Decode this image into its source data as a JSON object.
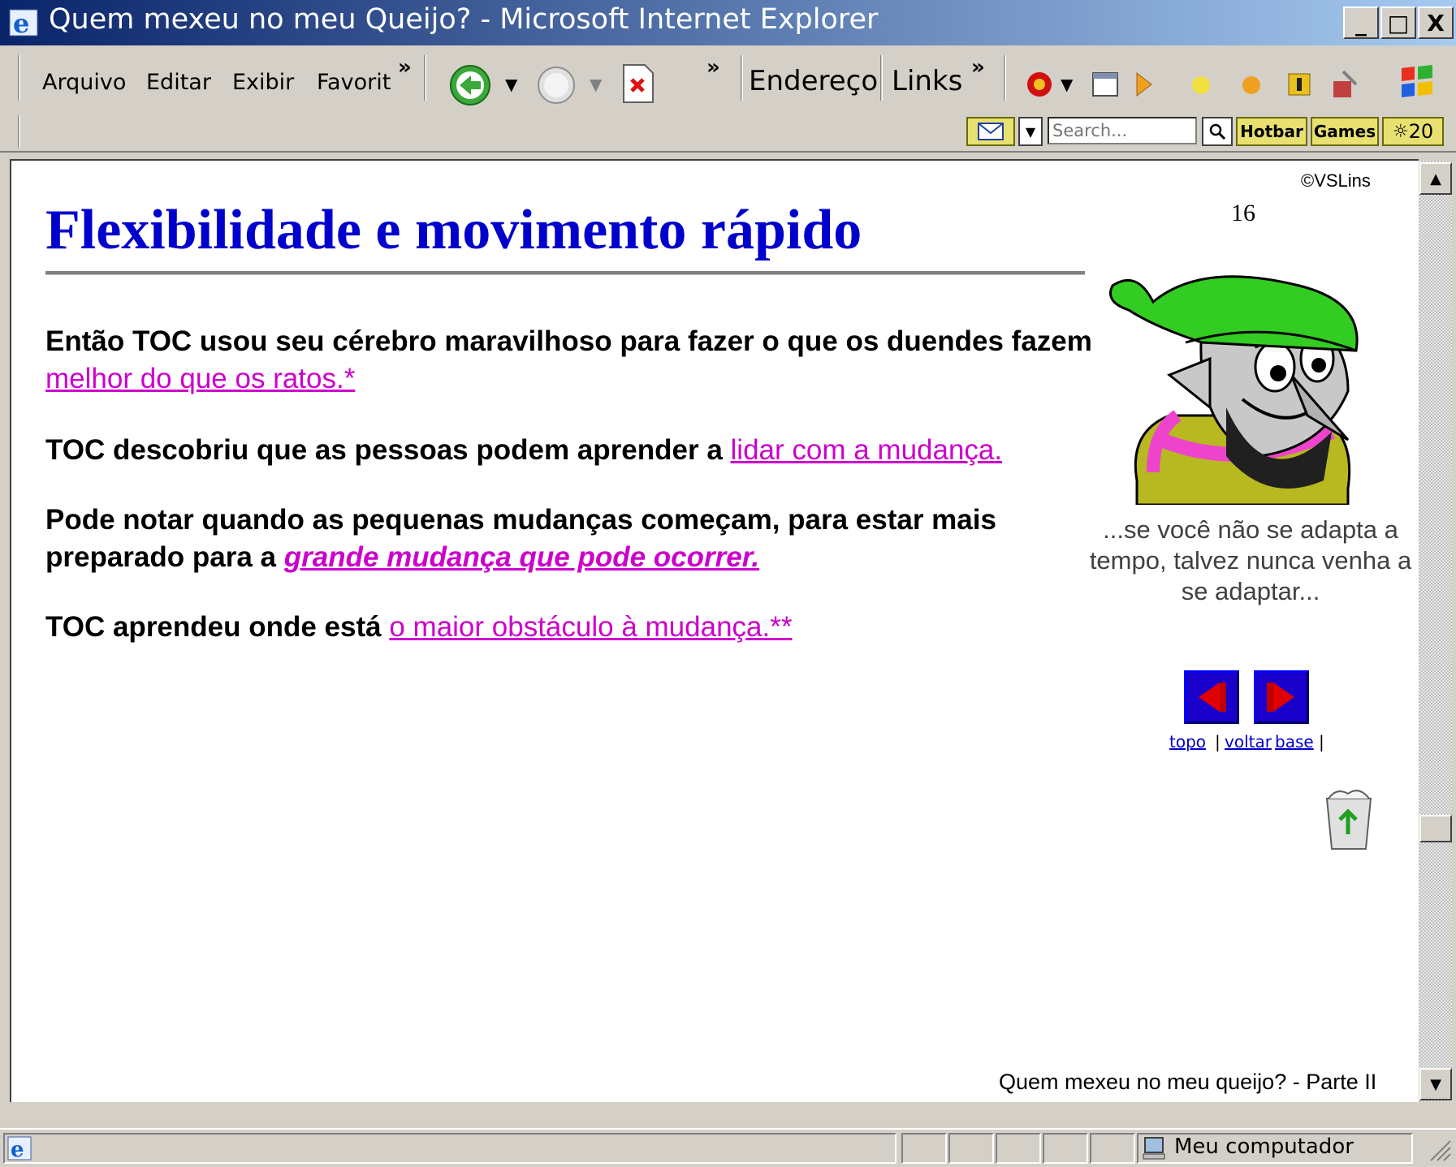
{
  "window": {
    "title": "Quem mexeu no meu Queijo? - Microsoft Internet Explorer",
    "minimize_label": "_",
    "maximize_label": "□",
    "close_label": "X"
  },
  "menu": {
    "items": [
      "Arquivo",
      "Editar",
      "Exibir",
      "Favorit"
    ],
    "overflow": "»"
  },
  "toolbar": {
    "overflow": "»",
    "address_label": "Endereço",
    "links_label": "Links",
    "links_overflow": "»"
  },
  "searchbar": {
    "placeholder": "Search...",
    "hotbar_label": "Hotbar",
    "games_label": "Games",
    "weather_label": "20"
  },
  "page": {
    "copyright": "©VSLins",
    "page_number": "16",
    "heading": "Flexibilidade e movimento rápido",
    "paragraphs": [
      {
        "text": "Então TOC usou seu cérebro maravilhoso para fazer o que os duendes fazem ",
        "link": "melhor do que os ratos.*"
      },
      {
        "text": "TOC descobriu que as pessoas podem aprender a ",
        "link": "lidar com a mudança."
      },
      {
        "text": "Pode notar quando as pequenas mudanças começam, para estar mais preparado para a ",
        "link": "grande mudança que pode ocorrer."
      },
      {
        "text": "TOC aprendeu onde está ",
        "link": "o maior obstáculo à mudança.**"
      }
    ],
    "caption": "...se você não se adapta a tempo, talvez nunca venha a se adaptar...",
    "nav": {
      "top": "topo",
      "back": "voltar",
      "bottom": "base",
      "separator": "|"
    },
    "footer": "Quem mexeu no meu queijo? - Parte II"
  },
  "status": {
    "zone": "Meu computador"
  },
  "colors": {
    "heading": "#0000cc",
    "link": "#cc00cc",
    "titlebar_start": "#0a246a",
    "titlebar_end": "#a6caf0"
  }
}
